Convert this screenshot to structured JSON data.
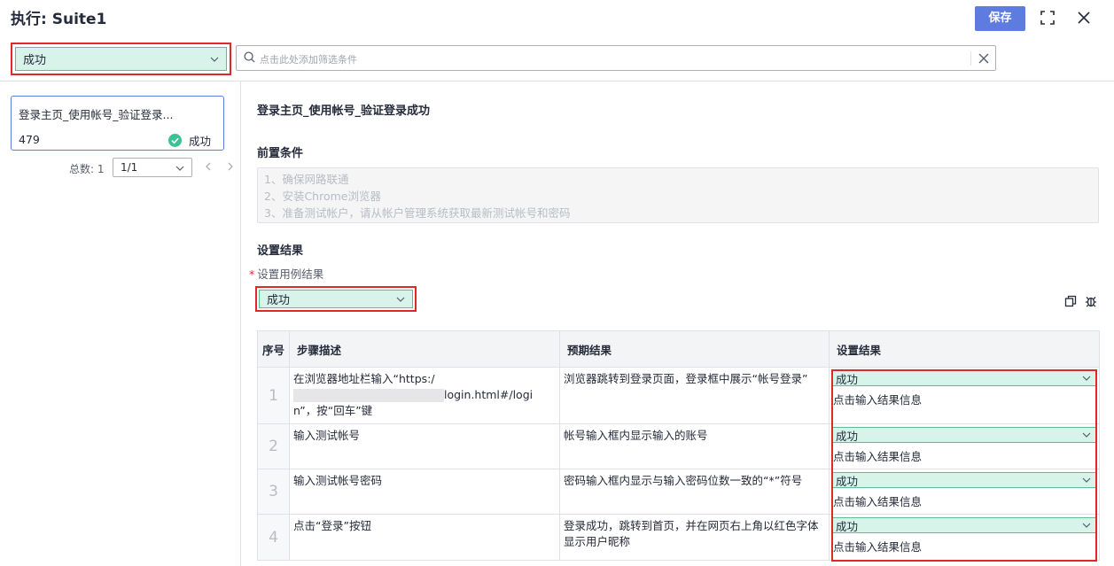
{
  "header": {
    "title": "执行: Suite1",
    "save_label": "保存",
    "icons": [
      "fullscreen-icon",
      "close-icon"
    ]
  },
  "filter": {
    "status_value": "成功",
    "search_placeholder": "点击此处添加筛选条件"
  },
  "case_list": {
    "items": [
      {
        "title": "登录主页_使用帐号_验证登录...",
        "id": "479",
        "status": "成功"
      }
    ],
    "total_label": "总数: 1",
    "page_value": "1/1"
  },
  "detail": {
    "case_title": "登录主页_使用帐号_验证登录成功",
    "precondition_title": "前置条件",
    "preconditions": [
      "1、确保网路联通",
      "2、安装Chrome浏览器",
      "3、准备测试帐户，请从帐户管理系统获取最新测试帐号和密码"
    ],
    "result_section_title": "设置结果",
    "case_result_label": "设置用例结果",
    "case_result_value": "成功"
  },
  "steps_table": {
    "headers": [
      "序号",
      "步骤描述",
      "预期结果",
      "设置结果"
    ],
    "rows": [
      {
        "num": "1",
        "desc_a": "在浏览器地址栏输入“https:/",
        "desc_b": "login.html#/login”，按“回车”键",
        "expected": "浏览器跳转到登录页面，登录框中展示“帐号登录”",
        "result": "成功",
        "info": "点击输入结果信息"
      },
      {
        "num": "2",
        "desc_a": "输入测试帐号",
        "expected": "帐号输入框内显示输入的账号",
        "result": "成功",
        "info": "点击输入结果信息"
      },
      {
        "num": "3",
        "desc_a": "输入测试帐号密码",
        "expected": "密码输入框内显示与输入密码位数一致的“*”符号",
        "result": "成功",
        "info": "点击输入结果信息"
      },
      {
        "num": "4",
        "desc_a": "点击“登录”按钮",
        "expected": "登录成功，跳转到首页，并在网页右上角以红色字体显示用户昵称",
        "result": "成功",
        "info": "点击输入结果信息"
      }
    ]
  },
  "colors": {
    "accent": "#5e7ce0",
    "success_bg": "#d8f3ea",
    "success_border": "#5bbf91",
    "success_icon": "#3ac295",
    "highlight": "#e02828"
  }
}
